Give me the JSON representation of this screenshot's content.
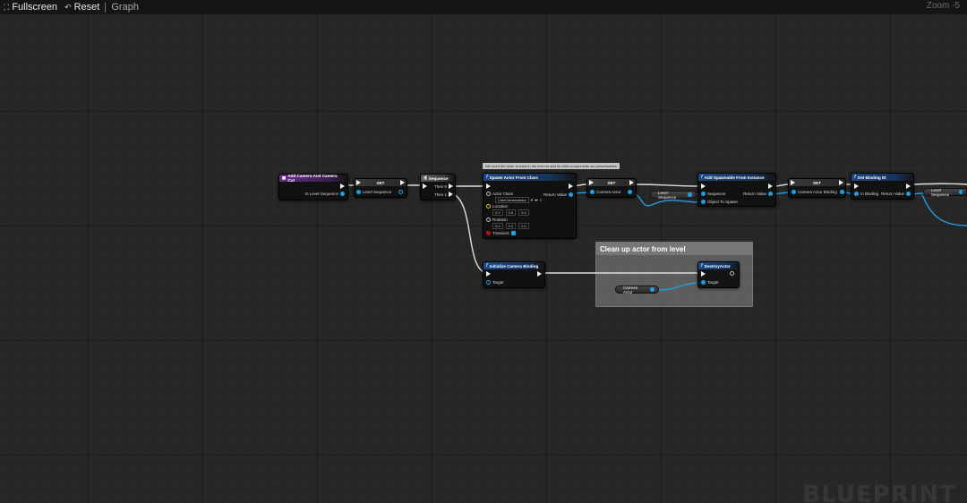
{
  "toolbar": {
    "fullscreen_label": "Fullscreen",
    "reset_label": "Reset",
    "graph_label": "Graph",
    "zoom_label": "Zoom -5"
  },
  "watermark": "BLUEPRINT",
  "comment": {
    "title": "Clean up actor from level"
  },
  "tooltip": "We need the actor to exist in the level to add its child components as possessables",
  "nodes": {
    "add_camera": {
      "title": "Add Camera And Camera Cut",
      "pin_level_sequence": "In Level Sequence"
    },
    "set1": {
      "title": "SET",
      "pin_level_sequence": "Level Sequence"
    },
    "sequence": {
      "title": "Sequence",
      "then0": "Then 0",
      "then1": "Then 1"
    },
    "spawn": {
      "title": "Spawn Actor From Class",
      "actor_class": "Actor Class",
      "actor_class_value": "CineCameraActor",
      "return_value": "Return Value",
      "location": "Location",
      "location_values": [
        "0.0",
        "0.0",
        "0.0"
      ],
      "rotation": "Rotation",
      "rotation_values": [
        "0.0",
        "0.0",
        "0.0"
      ],
      "transient": "Transient"
    },
    "set2": {
      "title": "SET",
      "pin_camera_actor": "Camera Actor"
    },
    "level_sequence_var1": "Level Sequence",
    "add_spawnable": {
      "title": "Add Spawnable From Instance",
      "sequence": "Sequence",
      "object_to_spawn": "Object To Spawn",
      "return_value": "Return Value"
    },
    "set3": {
      "title": "SET",
      "pin_binding": "Camera Actor Binding"
    },
    "get_binding": {
      "title": "Get Binding ID",
      "in_binding": "In Binding",
      "return_value": "Return Value"
    },
    "level_sequence_var2": "Level Sequence",
    "init_camera": {
      "title": "Initialize Camera Binding",
      "target": "Target"
    },
    "destroy": {
      "title": "DestroyActor",
      "target": "Target"
    },
    "camera_actor_var": "Camera Actor"
  },
  "colors": {
    "exec": "#eeeeee",
    "object_pin": "#1fa0e6",
    "function_header": "#1e4a86",
    "event_header": "#6b2f8c",
    "comment_title": "#777777"
  }
}
